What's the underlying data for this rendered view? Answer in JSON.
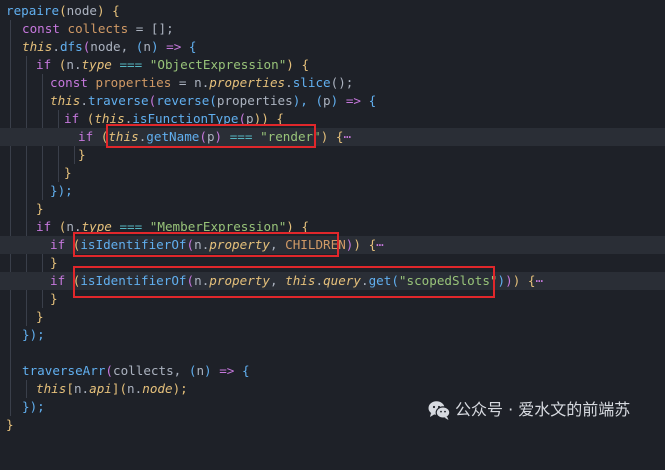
{
  "code": {
    "l1": {
      "fn": "repaire",
      "p1": "(",
      "arg": "node",
      "p2": ") {"
    },
    "l2": {
      "kw": "const",
      "name": "collects",
      "rest": " = [];"
    },
    "l3": {
      "this": "this",
      "dot": ".",
      "fn": "dfs",
      "p1": "(",
      "a": "node",
      "c": ", ",
      "p2": "(",
      "n": "n",
      "p3": ")",
      "arrow": " => ",
      "br": "{"
    },
    "l4": {
      "kw": "if",
      "p1": " (",
      "obj": "n",
      "dot": ".",
      "prop": "type",
      "op": " === ",
      "str": "\"ObjectExpression\"",
      "p2": ") {"
    },
    "l5": {
      "kw": "const",
      "name": "properties",
      "eq": " = ",
      "obj": "n",
      "dot": ".",
      "prop": "properties",
      "dot2": ".",
      "fn": "slice",
      "rest": "();"
    },
    "l6": {
      "this": "this",
      "dot": ".",
      "fn": "traverse",
      "p1": "(",
      "fn2": "reverse",
      "p2": "(",
      "a": "properties",
      "p3": "), ",
      "p4": "(",
      "p": "p",
      "p5": ")",
      "arrow": " => ",
      "br": "{"
    },
    "l7": {
      "kw": "if",
      "p1": " (",
      "this": "this",
      "dot": ".",
      "fn": "isFunctionType",
      "p2": "(",
      "p": "p",
      "p3": ")) {"
    },
    "l8": {
      "kw": "if",
      "p1": " (",
      "this": "this",
      "dot": ".",
      "fn": "getName",
      "p2": "(",
      "p": "p",
      "p3": ")",
      "op": " === ",
      "str": "\"render\"",
      "p4": ")",
      "br": " {",
      "fold": "⋯"
    },
    "l9": {
      "br": "}"
    },
    "l10": {
      "br": "}"
    },
    "l11": {
      "br": "});"
    },
    "l12": {
      "br": "}"
    },
    "l13": {
      "kw": "if",
      "p1": " (",
      "obj": "n",
      "dot": ".",
      "prop": "type",
      "op": " === ",
      "str": "\"MemberExpression\"",
      "p2": ") {"
    },
    "l14": {
      "kw": "if",
      "p1": " (",
      "fn": "isIdentifierOf",
      "p2": "(",
      "obj": "n",
      "dot": ".",
      "prop": "property",
      "c": ", ",
      "cst": "CHILDREN",
      "p3": ")",
      "p4": ")",
      "br": " {",
      "fold": "⋯"
    },
    "l15": {
      "br": "}"
    },
    "l16": {
      "kw": "if",
      "p1": " (",
      "fn": "isIdentifierOf",
      "p2": "(",
      "obj": "n",
      "dot": ".",
      "prop": "property",
      "c": ", ",
      "this": "this",
      "dot2": ".",
      "prop2": "query",
      "dot3": ".",
      "fn2": "get",
      "p3": "(",
      "str": "\"scopedSlots\"",
      "p4": ")",
      "p5": ")",
      "p6": ")",
      "br": " {",
      "fold": "⋯"
    },
    "l17": {
      "br": "}"
    },
    "l18": {
      "br": "}"
    },
    "l19": {
      "br": "});"
    },
    "l21": {
      "fn": "traverseArr",
      "p1": "(",
      "a": "collects",
      "c": ", ",
      "p2": "(",
      "n": "n",
      "p3": ")",
      "arrow": " => ",
      "br": "{"
    },
    "l22": {
      "this": "this",
      "p1": "[",
      "obj": "n",
      "dot": ".",
      "prop": "api",
      "p2": "](",
      "obj2": "n",
      "dot2": ".",
      "prop2": "node",
      "p3": ");"
    },
    "l23": {
      "br": "});"
    },
    "l24": {
      "br": "}"
    }
  },
  "watermark": {
    "text": "公众号 · 爱水文的前端苏",
    "icon": "wechat-icon"
  },
  "colors": {
    "background": "#1e2128",
    "highlight_box": "#e0272b",
    "keyword": "#c678dd",
    "function": "#61afef",
    "string": "#98c379"
  }
}
